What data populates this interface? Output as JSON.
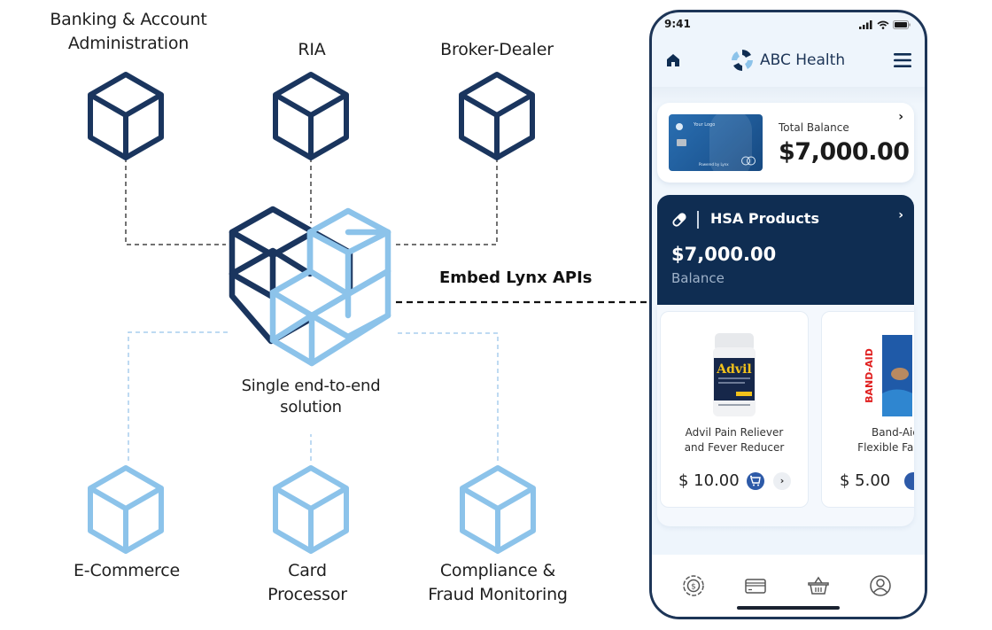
{
  "diagram": {
    "top_nodes": [
      {
        "label_lines": [
          "Banking & Account",
          "Administration"
        ]
      },
      {
        "label_lines": [
          "RIA"
        ]
      },
      {
        "label_lines": [
          "Broker-Dealer"
        ]
      }
    ],
    "center": {
      "label_lines": [
        "Single end-to-end",
        "solution"
      ]
    },
    "bottom_nodes": [
      {
        "label_lines": [
          "E-Commerce"
        ]
      },
      {
        "label_lines": [
          "Card",
          "Processor"
        ]
      },
      {
        "label_lines": [
          "Compliance &",
          "Fraud Monitoring"
        ]
      }
    ],
    "connector_label": "Embed Lynx APIs",
    "colors": {
      "dark": "#1a355e",
      "light": "#8cc3ea",
      "dark_line": "#444444",
      "light_line": "#a8cdee"
    }
  },
  "phone": {
    "status": {
      "time": "9:41"
    },
    "header": {
      "brand": "ABC Health",
      "home_icon": "home-icon",
      "menu_icon": "hamburger-menu-icon"
    },
    "total_balance": {
      "label": "Total Balance",
      "value": "$7,000.00",
      "card": {
        "logo_text": "Your Logo",
        "powered_text": "Powered by Lynx"
      }
    },
    "hsa": {
      "title": "HSA Products",
      "value": "$7,000.00",
      "subtitle": "Balance"
    },
    "products": [
      {
        "name_lines": [
          "Advil Pain Reliever",
          "and Fever Reducer"
        ],
        "price": "$ 10.00",
        "image": "advil-bottle",
        "brand_text": "Advil"
      },
      {
        "name_lines": [
          "Band-Aid",
          "Flexible Fabric"
        ],
        "price": "$ 5.00",
        "image": "band-aid-box",
        "brand_text": "BAND-AID"
      }
    ],
    "tabs": [
      {
        "icon": "dollar-coin-icon"
      },
      {
        "icon": "credit-card-icon"
      },
      {
        "icon": "basket-icon"
      },
      {
        "icon": "profile-icon"
      }
    ]
  },
  "colors": {
    "navy": "#0f2d52",
    "brand": "#1d3557",
    "accent": "#2d5aa8",
    "light_blue": "#8cc3ea"
  }
}
